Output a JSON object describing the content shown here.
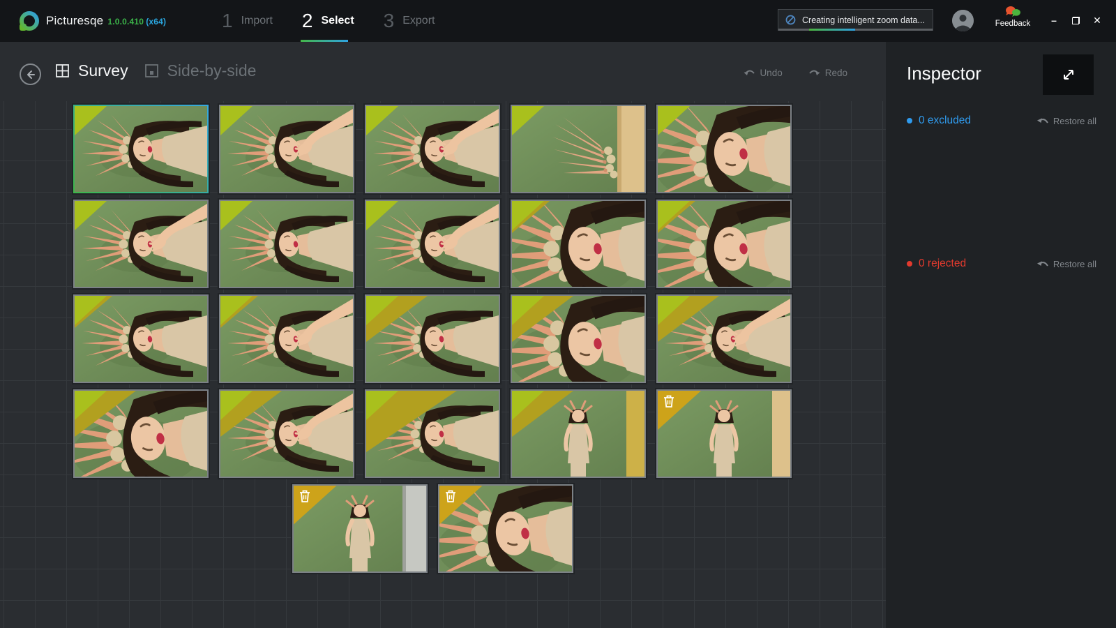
{
  "app": {
    "name": "Picturesqe",
    "version": "1.0.0.410",
    "arch": "(x64)"
  },
  "steps": [
    {
      "number": "1",
      "label": "Import",
      "active": false
    },
    {
      "number": "2",
      "label": "Select",
      "active": true
    },
    {
      "number": "3",
      "label": "Export",
      "active": false
    }
  ],
  "titlebar": {
    "status_message": "Creating intelligent zoom data...",
    "progress_segment": {
      "left_percent": 20,
      "width_percent": 30
    },
    "feedback_label": "Feedback",
    "minimize_glyph": "–",
    "close_glyph": "✕"
  },
  "toolbar": {
    "survey_label": "Survey",
    "side_by_side_label": "Side-by-side",
    "undo_label": "Undo",
    "redo_label": "Redo"
  },
  "inspector": {
    "title": "Inspector",
    "excluded_label": "0 excluded",
    "rejected_label": "0 rejected",
    "restore_all_excluded_label": "Restore all",
    "restore_all_rejected_label": "Restore all"
  },
  "grid": {
    "photo_count": 22,
    "rows": [
      [
        {
          "variant": "lying",
          "badge": "pick",
          "selected": true,
          "wedge": "none"
        },
        {
          "variant": "hand",
          "badge": "pick",
          "selected": false,
          "wedge": "none"
        },
        {
          "variant": "hand",
          "badge": "pick",
          "selected": false,
          "wedge": "none"
        },
        {
          "variant": "dolls",
          "badge": "pick",
          "selected": false,
          "wedge": "none"
        },
        {
          "variant": "face",
          "badge": "pick",
          "selected": false,
          "wedge": "none"
        }
      ],
      [
        {
          "variant": "hand",
          "badge": "pick",
          "selected": false,
          "wedge": "none"
        },
        {
          "variant": "lying",
          "badge": "pick",
          "selected": false,
          "wedge": "none"
        },
        {
          "variant": "hand",
          "badge": "pick",
          "selected": false,
          "wedge": "none"
        },
        {
          "variant": "face",
          "badge": "pick",
          "selected": false,
          "wedge": "s"
        },
        {
          "variant": "face",
          "badge": "pick",
          "selected": false,
          "wedge": "s"
        }
      ],
      [
        {
          "variant": "lying",
          "badge": "pick",
          "selected": false,
          "wedge": "s"
        },
        {
          "variant": "hand",
          "badge": "pick",
          "selected": false,
          "wedge": "s"
        },
        {
          "variant": "lying",
          "badge": "pick",
          "selected": false,
          "wedge": "m"
        },
        {
          "variant": "face",
          "badge": "pick",
          "selected": false,
          "wedge": "m"
        },
        {
          "variant": "hand",
          "badge": "pick",
          "selected": false,
          "wedge": "m"
        }
      ],
      [
        {
          "variant": "face",
          "badge": "pick",
          "selected": false,
          "wedge": "m"
        },
        {
          "variant": "hand",
          "badge": "pick",
          "selected": false,
          "wedge": "m"
        },
        {
          "variant": "lying",
          "badge": "pick",
          "selected": false,
          "wedge": "l"
        },
        {
          "variant": "stand-yellow",
          "badge": "pick",
          "selected": false,
          "wedge": "m"
        },
        {
          "variant": "stand-beige",
          "badge": "trash",
          "selected": false,
          "wedge": "s"
        }
      ],
      [
        {
          "variant": "stand-gray",
          "badge": "trash",
          "selected": false,
          "wedge": "none"
        },
        {
          "variant": "face",
          "badge": "trash",
          "selected": false,
          "wedge": "none"
        }
      ]
    ]
  },
  "colors": {
    "accent_green": "#45b649",
    "accent_blue": "#2fa3e0",
    "excluded_blue": "#2f9bee",
    "rejected_red": "#e23a2e",
    "badge_pick": "#a9c01d",
    "badge_trash": "#cda31a",
    "selection_border_green": "#3db54a",
    "selection_border_blue": "#35a8e0"
  }
}
